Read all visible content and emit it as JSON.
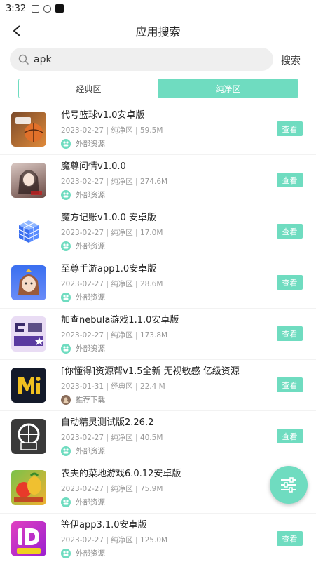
{
  "status_bar": {
    "time": "3:32"
  },
  "header": {
    "title": "应用搜索"
  },
  "search": {
    "value": "apk",
    "button_label": "搜索"
  },
  "tabs": [
    {
      "label": "经典区",
      "active": false
    },
    {
      "label": "纯净区",
      "active": true
    }
  ],
  "items": [
    {
      "name": "代号篮球v1.0安卓版",
      "meta": "2023-02-27 | 纯净区 | 59.5M",
      "source": "外部资源",
      "view": "查看",
      "icon": "basketball-game-icon"
    },
    {
      "name": "魔尊问情v1.0.0",
      "meta": "2023-02-27 | 纯净区 | 274.6M",
      "source": "外部资源",
      "view": "查看",
      "icon": "anime-girl-icon"
    },
    {
      "name": "魔方记账v1.0.0 安卓版",
      "meta": "2023-02-27 | 纯净区 | 17.0M",
      "source": "外部资源",
      "view": "查看",
      "icon": "rubiks-cube-icon"
    },
    {
      "name": "至尊手游app1.0安卓版",
      "meta": "2023-02-27 | 纯净区 | 28.6M",
      "source": "外部资源",
      "view": "查看",
      "icon": "cartoon-character-icon"
    },
    {
      "name": "加查nebula游戏1.1.0安卓版",
      "meta": "2023-02-27 | 纯净区 | 173.8M",
      "source": "外部资源",
      "view": "查看",
      "icon": "gacha-nebula-icon"
    },
    {
      "name": "[你懂得]资源帮v1.5全新 无视敏感 亿级资源",
      "meta": "2023-01-31 | 经典区 | 22.4 M",
      "source": "推荐下载",
      "view": "查看",
      "icon": "mi-logo-icon"
    },
    {
      "name": "自动精灵测试版2.26.2",
      "meta": "2023-02-27 | 纯净区 | 40.5M",
      "source": "外部资源",
      "view": "查看",
      "icon": "zd-logo-icon"
    },
    {
      "name": "农夫的菜地游戏6.0.12安卓版",
      "meta": "2023-02-27 | 纯净区 | 75.9M",
      "source": "外部资源",
      "view": "查看",
      "icon": "fruit-game-icon"
    },
    {
      "name": "等伊app3.1.0安卓版",
      "meta": "2023-02-27 | 纯净区 | 125.0M",
      "source": "外部资源",
      "view": "查看",
      "icon": "dengyi-logo-icon"
    }
  ],
  "colors": {
    "accent": "#6fdcc0",
    "background": "#f2f2f2"
  }
}
